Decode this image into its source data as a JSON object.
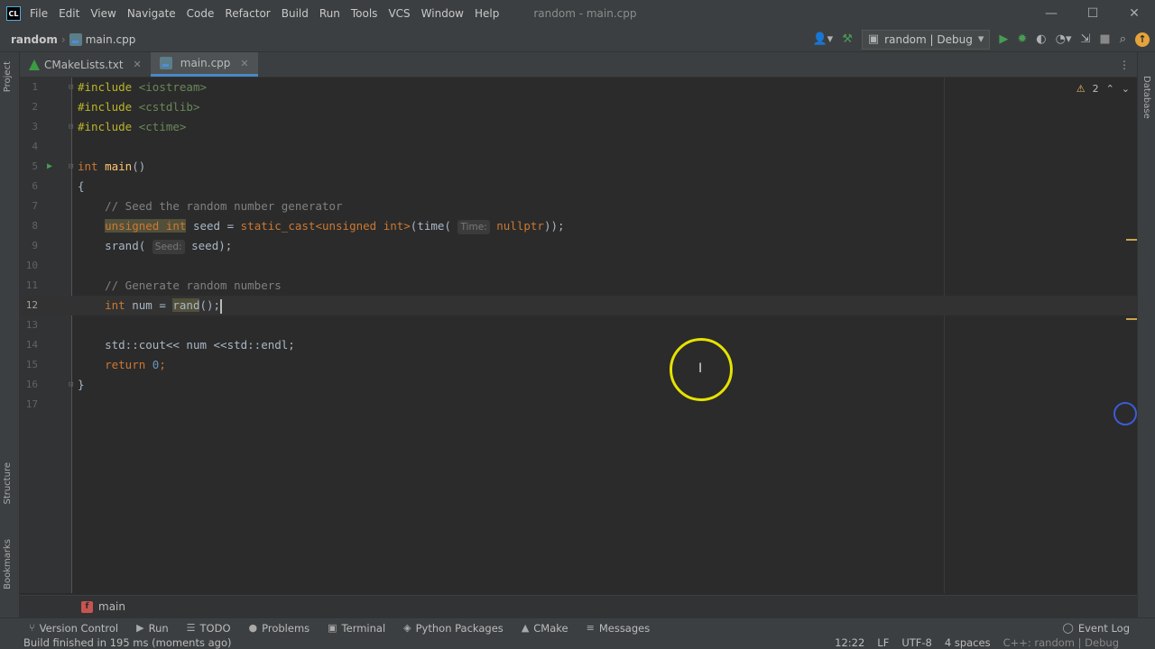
{
  "titlebar": {
    "app_icon": "CL",
    "menu": [
      "File",
      "Edit",
      "View",
      "Navigate",
      "Code",
      "Refactor",
      "Build",
      "Run",
      "Tools",
      "VCS",
      "Window",
      "Help"
    ],
    "window_title": "random - main.cpp",
    "controls": {
      "minimize": "—",
      "maximize": "☐",
      "close": "✕"
    }
  },
  "navbar": {
    "project": "random",
    "file": "main.cpp",
    "run_config": "random | Debug"
  },
  "tabs": [
    {
      "label": "CMakeLists.txt",
      "icon": "cmake-icon",
      "active": false
    },
    {
      "label": "main.cpp",
      "icon": "cpp-file-icon",
      "active": true
    }
  ],
  "side": {
    "left": [
      "Project",
      "Structure",
      "Bookmarks"
    ],
    "right": [
      "Database"
    ]
  },
  "inspections": {
    "warnings": "2"
  },
  "editor": {
    "line_numbers": [
      "1",
      "2",
      "3",
      "4",
      "5",
      "6",
      "7",
      "8",
      "9",
      "10",
      "11",
      "12",
      "13",
      "14",
      "15",
      "16",
      "17"
    ],
    "current_line": "12",
    "hints": {
      "time": "Time:",
      "seed": "Seed:"
    },
    "code": {
      "inc": "#include",
      "iostream": "<iostream>",
      "cstdlib": "<cstdlib>",
      "ctime": "<ctime>",
      "int": "int",
      "main_fn": "main",
      "parens": "()",
      "lbrace": "{",
      "rbrace": "}",
      "comment1": "// Seed the random number generator",
      "unsigned_int": "unsigned int",
      "seed_assign": " seed = ",
      "static_cast": "static_cast",
      "cast_type": "<unsigned int>",
      "time_call": "(time(",
      "nullptr": "nullptr",
      "close_paren": "));",
      "srand": "srand(",
      "seed_arg": "seed);",
      "comment2": "// Generate random numbers",
      "num_assign": " num = ",
      "rand": "rand",
      "rand_tail": "();",
      "cout_line": "std::cout<< num <<std::endl;",
      "return_kw": "return",
      "zero": "0",
      "semi": ";"
    }
  },
  "breadcrumb": {
    "badge": "f",
    "label": "main"
  },
  "toolwindows": [
    {
      "label": "Version Control",
      "icon": "vcs-icon"
    },
    {
      "label": "Run",
      "icon": "run-icon"
    },
    {
      "label": "TODO",
      "icon": "todo-icon"
    },
    {
      "label": "Problems",
      "icon": "problems-icon"
    },
    {
      "label": "Terminal",
      "icon": "terminal-icon"
    },
    {
      "label": "Python Packages",
      "icon": "packages-icon"
    },
    {
      "label": "CMake",
      "icon": "cmake-icon"
    },
    {
      "label": "Messages",
      "icon": "messages-icon"
    }
  ],
  "event_log": "Event Log",
  "status": {
    "message": "Build finished in 195 ms (moments ago)",
    "position": "12:22",
    "line_sep": "LF",
    "encoding": "UTF-8",
    "indent": "4 spaces",
    "context": "C++: random | Debug"
  }
}
